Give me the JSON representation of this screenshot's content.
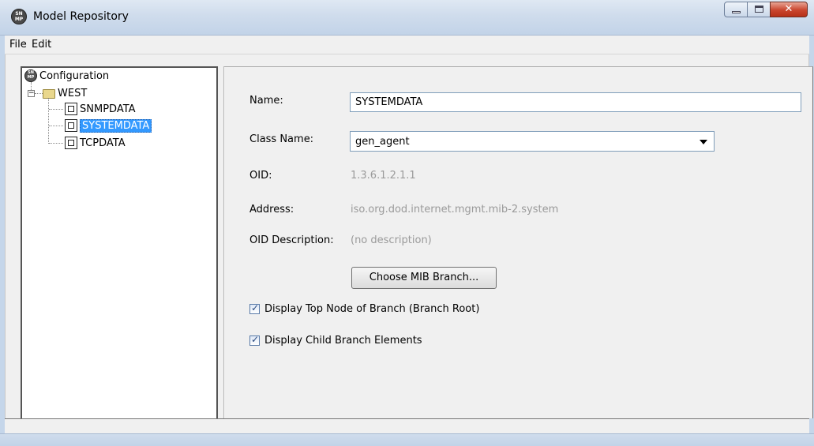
{
  "window": {
    "title": "Model Repository",
    "app_icon_text": "SN MP"
  },
  "menu": {
    "file": "File",
    "edit": "Edit"
  },
  "tree": {
    "root_label": "Configuration",
    "folder_label": "WEST",
    "items": [
      {
        "label": "SNMPDATA",
        "selected": false
      },
      {
        "label": "SYSTEMDATA",
        "selected": true
      },
      {
        "label": "TCPDATA",
        "selected": false
      }
    ]
  },
  "form": {
    "name_label": "Name:",
    "name_value": "SYSTEMDATA",
    "class_label": "Class Name:",
    "class_value": "gen_agent",
    "oid_label": "OID:",
    "oid_value": "1.3.6.1.2.1.1",
    "address_label": "Address:",
    "address_value": "iso.org.dod.internet.mgmt.mib-2.system",
    "oid_desc_label": "OID Description:",
    "oid_desc_value": "(no description)",
    "choose_button": "Choose MIB Branch...",
    "checkbox_top_node": "Display Top Node of Branch (Branch Root)",
    "checkbox_child": "Display Child Branch Elements",
    "checkbox_top_node_checked": true,
    "checkbox_child_checked": true
  },
  "colors": {
    "selection": "#3399ff",
    "disabled_text": "#9a9a9a",
    "close_button": "#c9452d"
  }
}
